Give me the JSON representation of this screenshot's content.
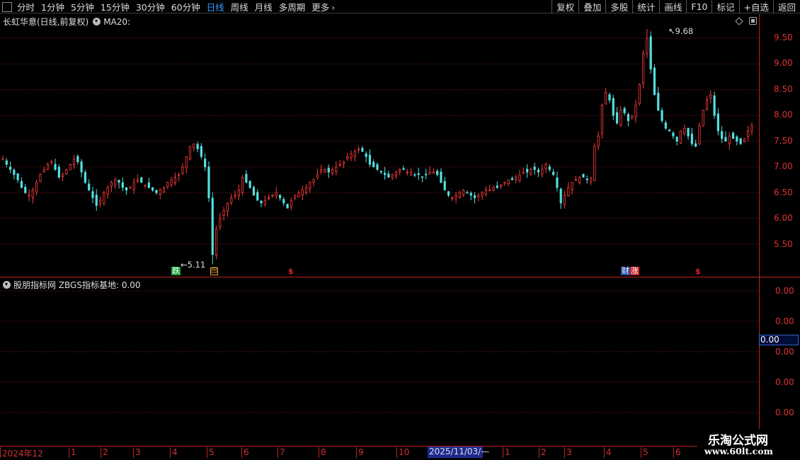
{
  "toolbar": {
    "periods": [
      "分时",
      "1分钟",
      "5分钟",
      "15分钟",
      "30分钟",
      "60分钟",
      "日线",
      "周线",
      "月线",
      "多周期",
      "更多"
    ],
    "active_period": "日线",
    "buttons": [
      "复权",
      "叠加",
      "多股",
      "统计",
      "画线",
      "F10",
      "标记",
      "+自选",
      "返回"
    ]
  },
  "main_panel": {
    "stock_title": "长虹华意(日线,前复权)",
    "ma_label": "MA20:",
    "high_annotation": "9.68",
    "low_annotation": "5.11",
    "markers": {
      "die": "跌",
      "hui": "回",
      "dollar": "$",
      "cai": "财",
      "zhang": "涨"
    }
  },
  "price_axis": {
    "ticks": [
      "9.50",
      "9.00",
      "8.50",
      "8.00",
      "7.50",
      "7.00",
      "6.50",
      "6.00",
      "5.50"
    ]
  },
  "indicator_panel": {
    "title": "股朋指标网 ZBGS指标基地: 0.00",
    "axis_ticks": [
      "0.00",
      "0.00",
      "0.00",
      "0.00",
      "0.00"
    ],
    "current_value": "0.00"
  },
  "date_axis": {
    "labels": [
      "2024年12",
      "1",
      "2",
      "3",
      "4",
      "5",
      "6",
      "7",
      "8",
      "9",
      "10",
      "1",
      "2",
      "3",
      "4",
      "5",
      "6"
    ],
    "cursor_label": "2025/11/03/—"
  },
  "watermark": {
    "name": "乐淘公式网",
    "url": "www.60lt.com"
  },
  "chart_data": {
    "type": "candlestick",
    "title": "",
    "ylim": [
      5.0,
      9.9
    ],
    "high": 9.68,
    "low": 5.11,
    "close_series": [
      7.15,
      7.05,
      6.95,
      6.85,
      6.75,
      6.6,
      6.5,
      6.45,
      6.55,
      6.7,
      6.85,
      6.95,
      7.05,
      7.1,
      6.95,
      6.8,
      6.85,
      6.95,
      7.05,
      7.15,
      7.1,
      6.9,
      6.7,
      6.55,
      6.4,
      6.25,
      6.35,
      6.5,
      6.6,
      6.7,
      6.75,
      6.7,
      6.6,
      6.55,
      6.6,
      6.7,
      6.75,
      6.7,
      6.65,
      6.6,
      6.55,
      6.5,
      6.55,
      6.6,
      6.7,
      6.75,
      6.8,
      6.85,
      7.0,
      7.2,
      7.4,
      7.45,
      7.35,
      7.2,
      7.0,
      6.4,
      5.3,
      5.8,
      6.0,
      6.15,
      6.3,
      6.4,
      6.45,
      6.55,
      6.8,
      6.7,
      6.6,
      6.45,
      6.35,
      6.3,
      6.35,
      6.4,
      6.45,
      6.5,
      6.4,
      6.3,
      6.2,
      6.35,
      6.45,
      6.5,
      6.55,
      6.6,
      6.7,
      6.75,
      6.85,
      6.95,
      6.95,
      6.9,
      6.95,
      7.0,
      7.05,
      7.1,
      7.2,
      7.25,
      7.3,
      7.35,
      7.3,
      7.2,
      7.05,
      7.0,
      6.95,
      6.9,
      6.85,
      6.8,
      6.85,
      6.9,
      6.95,
      6.95,
      6.9,
      6.9,
      6.85,
      6.85,
      6.8,
      6.85,
      6.9,
      6.9,
      6.85,
      6.7,
      6.55,
      6.45,
      6.4,
      6.45,
      6.5,
      6.55,
      6.5,
      6.45,
      6.4,
      6.45,
      6.5,
      6.55,
      6.55,
      6.6,
      6.6,
      6.65,
      6.7,
      6.75,
      6.75,
      6.8,
      6.85,
      6.9,
      6.9,
      6.95,
      6.95,
      6.9,
      6.95,
      7.05,
      6.95,
      6.85,
      6.6,
      6.3,
      6.45,
      6.6,
      6.7,
      6.75,
      6.8,
      6.8,
      6.75,
      6.78,
      7.4,
      7.6,
      8.2,
      8.45,
      8.3,
      8.0,
      7.85,
      8.1,
      8.05,
      7.9,
      8.0,
      8.2,
      8.6,
      9.2,
      9.5,
      8.9,
      8.4,
      8.1,
      7.9,
      7.75,
      7.7,
      7.6,
      7.5,
      7.7,
      7.75,
      7.6,
      7.45,
      7.4,
      7.8,
      8.1,
      8.3,
      8.4,
      8.0,
      7.7,
      7.55,
      7.5,
      7.6,
      7.55,
      7.5,
      7.45,
      7.55,
      7.7,
      7.8
    ]
  }
}
